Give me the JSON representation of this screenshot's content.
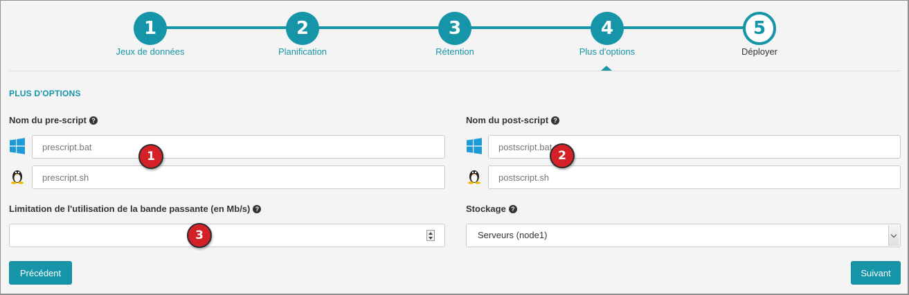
{
  "stepper": {
    "steps": [
      {
        "number": "1",
        "label": "Jeux de données"
      },
      {
        "number": "2",
        "label": "Planification"
      },
      {
        "number": "3",
        "label": "Rétention"
      },
      {
        "number": "4",
        "label": "Plus d'options"
      },
      {
        "number": "5",
        "label": "Déployer"
      }
    ],
    "active_step": 4
  },
  "section": {
    "title": "PLUS D'OPTIONS"
  },
  "prescript": {
    "label": "Nom du pre-script",
    "windows_placeholder": "prescript.bat",
    "linux_placeholder": "prescript.sh"
  },
  "postscript": {
    "label": "Nom du post-script",
    "windows_placeholder": "postscript.bat",
    "linux_placeholder": "postscript.sh"
  },
  "bandwidth": {
    "label": "Limitation de l'utilisation de la bande passante (en Mb/s)",
    "value": ""
  },
  "storage": {
    "label": "Stockage",
    "selected": "Serveurs (node1)"
  },
  "buttons": {
    "previous": "Précédent",
    "next": "Suivant"
  },
  "annotations": [
    "1",
    "2",
    "3"
  ],
  "colors": {
    "accent": "#1695a8",
    "badge": "#d42027"
  }
}
